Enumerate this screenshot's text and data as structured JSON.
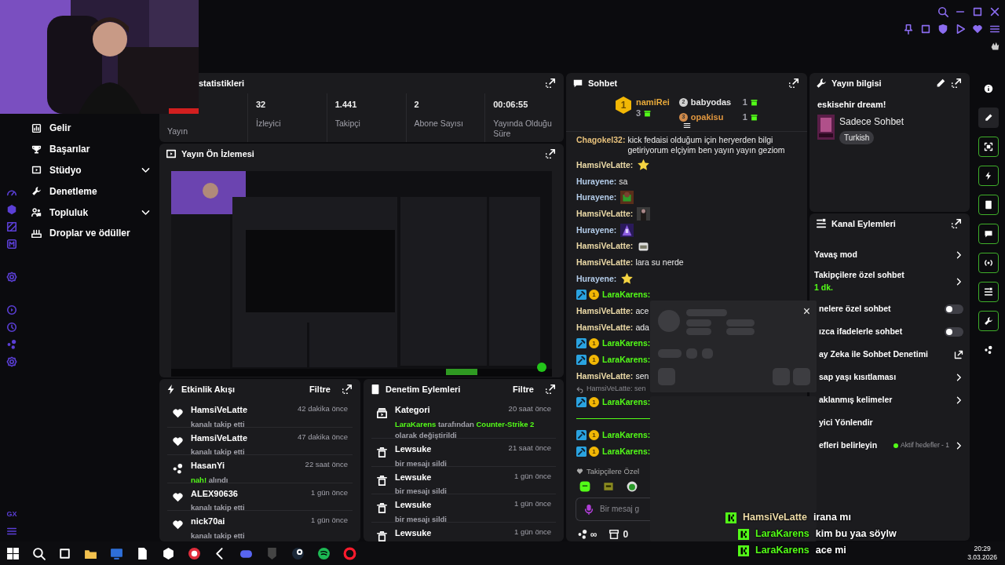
{
  "browser_rail": {
    "label": "GX"
  },
  "nav": [
    {
      "label": "Gelir",
      "has_submenu": false
    },
    {
      "label": "Başarılar",
      "has_submenu": false
    },
    {
      "label": "Stüdyo",
      "has_submenu": true
    },
    {
      "label": "Denetleme",
      "has_submenu": false
    },
    {
      "label": "Topluluk",
      "has_submenu": true
    },
    {
      "label": "Droplar ve ödüller",
      "has_submenu": false
    }
  ],
  "stats": {
    "title": "statistikleri",
    "items": [
      {
        "label": "Yayın"
      },
      {
        "value": "32",
        "label": "İzleyici"
      },
      {
        "value": "1.441",
        "label": "Takipçi"
      },
      {
        "value": "2",
        "label": "Abone Sayısı"
      },
      {
        "value": "00:06:55",
        "label": "Yayında Olduğu Süre"
      }
    ]
  },
  "preview": {
    "title": "Yayın Ön İzlemesi"
  },
  "activity": {
    "title": "Etkinlik Akışı",
    "filter": "Filtre",
    "items": [
      {
        "kind": "follow",
        "user": "HamsiVeLatte",
        "time": "42 dakika önce",
        "text": "kanalı takip etti"
      },
      {
        "kind": "follow",
        "user": "HamsiVeLatte",
        "time": "47 dakika önce",
        "text": "kanalı takip etti"
      },
      {
        "kind": "reward",
        "user": "HasanYi",
        "time": "22 saat önce",
        "highlight": "nah!",
        "text": "alındı"
      },
      {
        "kind": "follow",
        "user": "ALEX90636",
        "time": "1 gün önce",
        "text": "kanalı takip etti"
      },
      {
        "kind": "follow",
        "user": "nick70ai",
        "time": "1 gün önce",
        "text": "kanalı takip etti"
      }
    ]
  },
  "mod_actions": {
    "title": "Denetim Eylemleri",
    "filter": "Filtre",
    "items": [
      {
        "kind": "category",
        "user": "Kategori",
        "time": "20 saat önce",
        "segments": [
          {
            "text": "LaraKarens",
            "highlight": true
          },
          {
            "text": "tarafından",
            "highlight": false
          },
          {
            "text": "Counter-Strike 2",
            "highlight": true
          },
          {
            "text": "olarak değiştirildi",
            "highlight": false
          }
        ]
      },
      {
        "kind": "delete",
        "user": "Lewsuke",
        "time": "21 saat önce",
        "text": "bir mesajı sildi"
      },
      {
        "kind": "delete",
        "user": "Lewsuke",
        "time": "1 gün önce",
        "text": "bir mesajı sildi"
      },
      {
        "kind": "delete",
        "user": "Lewsuke",
        "time": "1 gün önce",
        "text": "bir mesajı sildi"
      },
      {
        "kind": "delete",
        "user": "Lewsuke",
        "time": "1 gün önce"
      }
    ]
  },
  "chat": {
    "title": "Sohbet",
    "leaders": [
      {
        "rank": "1",
        "name": "namiRei",
        "gifts": "3",
        "color": "#e8a93a"
      },
      {
        "rank": "2",
        "name": "babyodas",
        "gifts": "1",
        "color": "#e6e6e6"
      },
      {
        "rank": "3",
        "name": "opakisu",
        "gifts": "1",
        "color": "#e0963f"
      }
    ],
    "messages": [
      {
        "kind": "text",
        "user": "Chagokel32:",
        "color": "#e6c07b",
        "text": "kick fedaisi olduğum için heryerden bilgi getiriyorum elçiyim ben yayın yayın geziom"
      },
      {
        "kind": "emote",
        "user": "HamsiVeLatte:",
        "color": "#eddba8"
      },
      {
        "kind": "text",
        "user": "Hurayene:",
        "color": "#b4cdea",
        "text": "sa"
      },
      {
        "kind": "emote",
        "user": "Hurayene:",
        "color": "#b4cdea"
      },
      {
        "kind": "emote",
        "user": "HamsiVeLatte:",
        "color": "#eddba8"
      },
      {
        "kind": "emote",
        "user": "Hurayene:",
        "color": "#b4cdea"
      },
      {
        "kind": "emote",
        "user": "HamsiVeLatte:",
        "color": "#eddba8"
      },
      {
        "kind": "text",
        "user": "HamsiVeLatte:",
        "color": "#eddba8",
        "text": "lara su nerde"
      },
      {
        "kind": "emote",
        "user": "Hurayene:",
        "color": "#b4cdea"
      },
      {
        "kind": "text",
        "user": "LaraKarens:",
        "color": "#53fc18",
        "mod": true,
        "sub_badge": "1"
      },
      {
        "kind": "text",
        "user": "HamsiVeLatte:",
        "color": "#eddba8",
        "text": "ace"
      },
      {
        "kind": "text",
        "user": "HamsiVeLatte:",
        "color": "#eddba8",
        "text": "ada"
      },
      {
        "kind": "text",
        "user": "LaraKarens:",
        "color": "#53fc18",
        "mod": true,
        "sub_badge": "1"
      },
      {
        "kind": "text",
        "user": "LaraKarens:",
        "color": "#53fc18",
        "mod": true,
        "sub_badge": "1"
      },
      {
        "kind": "text",
        "user": "HamsiVeLatte:",
        "color": "#eddba8",
        "text": "sen"
      },
      {
        "kind": "text",
        "user": "LaraKarens:",
        "color": "#53fc18",
        "mod": true,
        "sub_badge": "1",
        "reply_to": "HamsiVeLatte: sen"
      },
      {
        "kind": "divider"
      },
      {
        "kind": "text",
        "user": "LaraKarens:",
        "color": "#53fc18",
        "mod": true,
        "sub_badge": "1"
      },
      {
        "kind": "text",
        "user": "LaraKarens:",
        "color": "#53fc18",
        "mod": true,
        "sub_badge": "1"
      }
    ],
    "emote_group": "Takipçilere Özel",
    "input": {
      "placeholder": "Bir mesaj g"
    },
    "footer": {
      "points": "∞",
      "store": "0"
    }
  },
  "info": {
    "title": "Yayın bilgisi",
    "stream_title": "eskisehir dream!",
    "category": "Sadece Sohbet",
    "tag": "Turkish"
  },
  "actions": {
    "title": "Kanal Eylemleri",
    "items": [
      {
        "kind": "link",
        "label": "Yavaş mod",
        "clipped": false
      },
      {
        "kind": "link",
        "label": "Takipçilere özel sohbet",
        "sub": "1 dk.",
        "clipped": false
      },
      {
        "kind": "toggle",
        "label": "nelere özel sohbet",
        "on": false,
        "clipped": true
      },
      {
        "kind": "toggle",
        "label": "ızca ifadelerle sohbet",
        "on": false,
        "clipped": true
      },
      {
        "kind": "external",
        "label": "ay Zeka ile Sohbet Denetimi",
        "clipped": true
      },
      {
        "kind": "link",
        "label": "sap yaşı kısıtlaması",
        "clipped": true
      },
      {
        "kind": "link",
        "label": "aklanmış kelimeler",
        "clipped": true
      },
      {
        "kind": "plain",
        "label": "yici Yönlendir",
        "clipped": true
      },
      {
        "kind": "link",
        "label": "efleri belirleyin",
        "status": "Aktif hedefler - 1",
        "clipped": true
      }
    ]
  },
  "tools": [
    {
      "active": false
    },
    {
      "active": false
    },
    {
      "active": true
    },
    {
      "active": true
    },
    {
      "active": true
    },
    {
      "active": true
    },
    {
      "active": true
    },
    {
      "active": true
    },
    {
      "active": true
    },
    {
      "active": false
    }
  ],
  "popup": {
    "close": "×"
  },
  "overlay_chat": [
    {
      "user": "HamsiVeLatte",
      "text": "irana mı",
      "color": "#eddba8"
    },
    {
      "user": "LaraKarens",
      "text": "kim bu yaa söylw",
      "color": "#53fc18"
    },
    {
      "user": "LaraKarens",
      "text": "ace mi",
      "color": "#53fc18"
    }
  ],
  "taskbar": {
    "time": "20:29",
    "date": "3.03.2026"
  }
}
